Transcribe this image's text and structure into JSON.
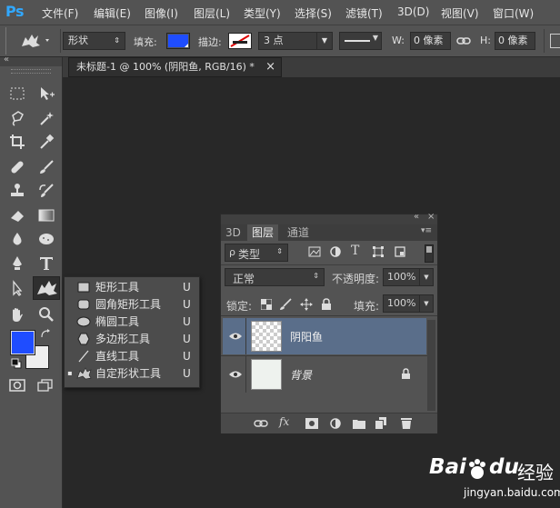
{
  "app": {
    "logo": "Ps"
  },
  "menu": [
    "文件(F)",
    "编辑(E)",
    "图像(I)",
    "图层(L)",
    "类型(Y)",
    "选择(S)",
    "滤镜(T)",
    "3D(D)",
    "视图(V)",
    "窗口(W)"
  ],
  "options": {
    "mode_value": "形状",
    "fill_label": "填充:",
    "fill_color": "#1f4dff",
    "stroke_label": "描边:",
    "stroke_width": "3 点",
    "w_label": "W:",
    "w_value": "0 像素",
    "h_label": "H:",
    "h_value": "0 像素"
  },
  "document_tab": {
    "title": "未标题-1 @ 100% (阴阳鱼, RGB/16) *",
    "close": "×"
  },
  "tools": {
    "collapse": "«",
    "foreground_color": "#1f4dff",
    "background_color": "#eeeeee"
  },
  "flyout": {
    "items": [
      {
        "label": "矩形工具",
        "key": "U",
        "selected": false
      },
      {
        "label": "圆角矩形工具",
        "key": "U",
        "selected": false
      },
      {
        "label": "椭圆工具",
        "key": "U",
        "selected": false
      },
      {
        "label": "多边形工具",
        "key": "U",
        "selected": false
      },
      {
        "label": "直线工具",
        "key": "U",
        "selected": false
      },
      {
        "label": "自定形状工具",
        "key": "U",
        "selected": true
      }
    ],
    "bullet": "▪"
  },
  "layers_panel": {
    "header_arrows": "«",
    "header_close": "×",
    "tabs": [
      "3D",
      "图层",
      "通道"
    ],
    "filter_label": "类型",
    "filter_icon": "ρ",
    "blend_mode": "正常",
    "opacity_label": "不透明度:",
    "opacity_value": "100%",
    "lock_label": "锁定:",
    "fill_label": "填充:",
    "fill_value": "100%",
    "layers": [
      {
        "name": "阴阳鱼",
        "selected": true
      },
      {
        "name": "背景",
        "selected": false
      }
    ],
    "footer_fx": "fx"
  },
  "watermark": {
    "brand": "Bai",
    "brand2": "du",
    "cn": "经验",
    "url": "jingyan.baidu.com"
  }
}
